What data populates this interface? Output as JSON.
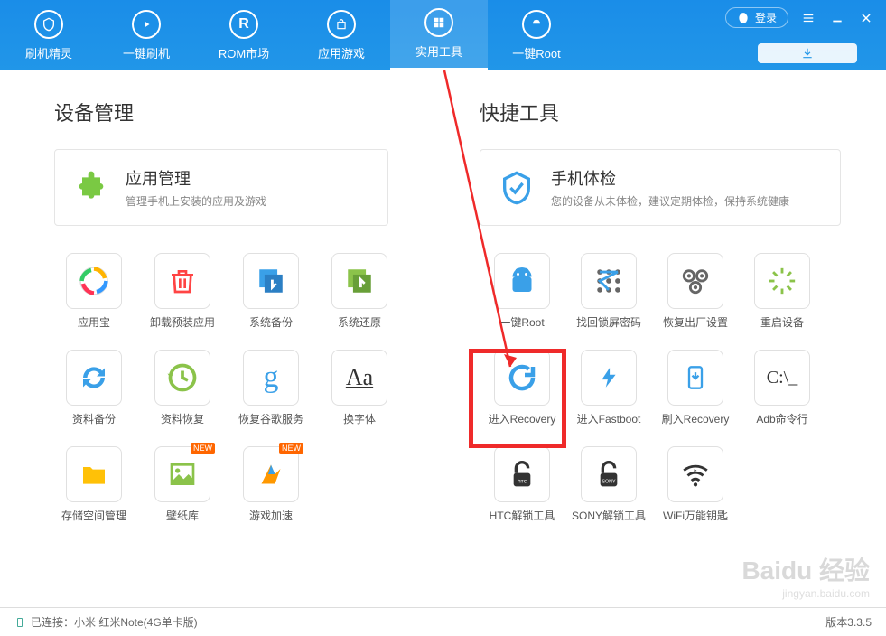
{
  "nav": [
    {
      "label": "刷机精灵"
    },
    {
      "label": "一键刷机"
    },
    {
      "label": "ROM市场"
    },
    {
      "label": "应用游戏"
    },
    {
      "label": "实用工具"
    },
    {
      "label": "一键Root"
    }
  ],
  "login": "登录",
  "left": {
    "title": "设备管理",
    "banner": {
      "title": "应用管理",
      "sub": "管理手机上安装的应用及游戏"
    },
    "tools": [
      {
        "label": "应用宝"
      },
      {
        "label": "卸载预装应用"
      },
      {
        "label": "系统备份"
      },
      {
        "label": "系统还原"
      },
      {
        "label": "资料备份"
      },
      {
        "label": "资料恢复"
      },
      {
        "label": "恢复谷歌服务"
      },
      {
        "label": "换字体"
      },
      {
        "label": "存储空间管理"
      },
      {
        "label": "壁纸库",
        "badge": "NEW"
      },
      {
        "label": "游戏加速",
        "badge": "NEW"
      }
    ]
  },
  "right": {
    "title": "快捷工具",
    "banner": {
      "title": "手机体检",
      "sub": "您的设备从未体检，建议定期体检，保持系统健康"
    },
    "tools": [
      {
        "label": "一键Root"
      },
      {
        "label": "找回锁屏密码"
      },
      {
        "label": "恢复出厂设置"
      },
      {
        "label": "重启设备"
      },
      {
        "label": "进入Recovery"
      },
      {
        "label": "进入Fastboot"
      },
      {
        "label": "刷入Recovery"
      },
      {
        "label": "Adb命令行"
      },
      {
        "label": "HTC解锁工具"
      },
      {
        "label": "SONY解锁工具"
      },
      {
        "label": "WiFi万能钥匙"
      }
    ]
  },
  "footer": {
    "status": "已连接：小米 红米Note(4G单卡版)",
    "version": "版本3.3.5"
  },
  "watermark": {
    "brand": "Baidu 经验",
    "url": "jingyan.baidu.com"
  }
}
